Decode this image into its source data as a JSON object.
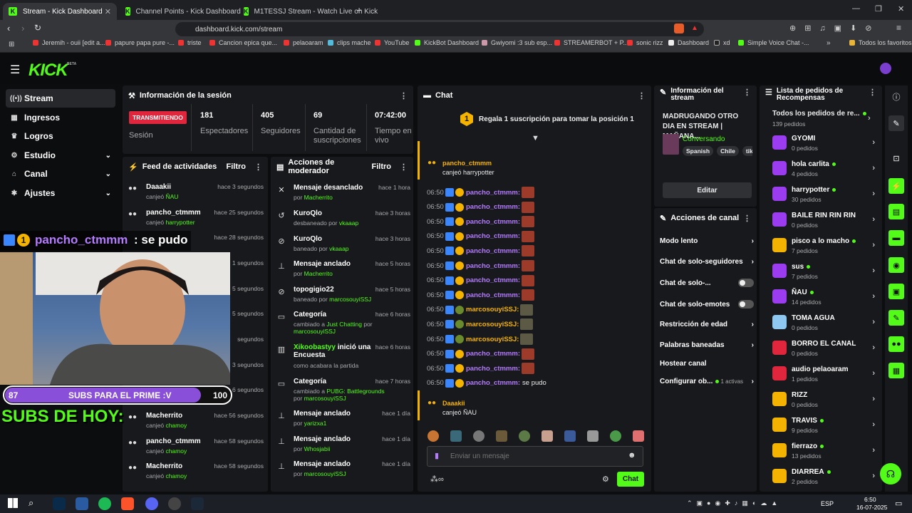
{
  "browser": {
    "tabs": [
      {
        "title": "Stream - Kick Dashboard",
        "active": true
      },
      {
        "title": "Channel Points - Kick Dashboard",
        "active": false
      },
      {
        "title": "M1TESSJ Stream - Watch Live on Kick",
        "active": false
      }
    ],
    "url": "dashboard.kick.com/stream",
    "bookmarks": [
      "Jeremih - ouii [edit a...",
      "papure papa pure -...",
      "triste",
      "Cancion epica que...",
      "pelaoaram",
      "clips mache",
      "YouTube",
      "KickBot Dashboard",
      "Gwiyomi :3 sub esp...",
      "STREAMERBOT + P...",
      "sonic rizz",
      "Dashboard",
      "xd",
      "Simple Voice Chat -..."
    ],
    "all_favorites": "Todos los favoritos"
  },
  "header": {
    "logo": "KICK",
    "beta": "BETA"
  },
  "sidebar": {
    "items": [
      {
        "label": "Stream",
        "icon": "broadcast-icon",
        "active": true
      },
      {
        "label": "Ingresos",
        "icon": "wallet-icon"
      },
      {
        "label": "Logros",
        "icon": "trophy-icon"
      },
      {
        "label": "Estudio",
        "icon": "studio-icon",
        "expandable": true
      },
      {
        "label": "Canal",
        "icon": "channel-icon",
        "expandable": true
      },
      {
        "label": "Ajustes",
        "icon": "settings-icon",
        "expandable": true
      }
    ]
  },
  "session": {
    "title": "Información de la sesión",
    "status": "TRANSMITIENDO",
    "status_label": "Sesión",
    "stats": [
      {
        "value": "181",
        "label": "Espectadores"
      },
      {
        "value": "405",
        "label": "Seguidores"
      },
      {
        "value": "69",
        "label": "Cantidad de suscripciones"
      },
      {
        "value": "07:42:00",
        "label": "Tiempo en vivo"
      }
    ]
  },
  "activity": {
    "title": "Feed de actividades",
    "filter": "Filtro",
    "items": [
      {
        "user": "Daaakii",
        "action": "canjeó",
        "target": "ÑAU",
        "time": "hace 3 segundos"
      },
      {
        "user": "pancho_ctmmm",
        "action": "canjeó",
        "target": "harrypotter",
        "time": "hace 25 segundos"
      },
      {
        "user": "",
        "action": "",
        "target": "harrypotter",
        "time": "hace 28 segundos"
      },
      {
        "user": "",
        "action": "",
        "target": "",
        "time": "1 segundos"
      },
      {
        "user": "",
        "action": "",
        "target": "",
        "time": "5 segundos"
      },
      {
        "user": "",
        "action": "",
        "target": "",
        "time": "5 segundos"
      },
      {
        "user": "",
        "action": "",
        "target": "",
        "time": "segundos"
      },
      {
        "user": "",
        "action": "",
        "target": "",
        "time": "3 segundos"
      },
      {
        "user": "",
        "action": "",
        "target": "",
        "time": "6 segundos"
      },
      {
        "user": "Macherrito",
        "action": "canjeó",
        "target": "chamoy",
        "time": "hace 56 segundos"
      },
      {
        "user": "pancho_ctmmm",
        "action": "canjeó",
        "target": "chamoy",
        "time": "hace 58 segundos"
      },
      {
        "user": "Macherrito",
        "action": "canjeó",
        "target": "chamoy",
        "time": "hace 58 segundos"
      }
    ]
  },
  "moderator": {
    "title": "Acciones de moderador",
    "filter": "Filtro",
    "items": [
      {
        "icon": "unpin-icon",
        "title": "Mensaje desanclado",
        "sub": "por",
        "by": "Macherrito",
        "time": "hace 1 hora"
      },
      {
        "icon": "unban-icon",
        "title": "KuroQlo",
        "sub": "desbaneado por",
        "by": "vkaaap",
        "time": "hace 3 horas"
      },
      {
        "icon": "ban-icon",
        "title": "KuroQlo",
        "sub": "baneado por",
        "by": "vkaaap",
        "time": "hace 3 horas"
      },
      {
        "icon": "pin-icon",
        "title": "Mensaje anclado",
        "sub": "por",
        "by": "Macherrito",
        "time": "hace 5 horas"
      },
      {
        "icon": "ban-icon",
        "title": "topogigio22",
        "sub": "baneado por",
        "by": "marcosouyiSSJ",
        "time": "hace 5 horas"
      },
      {
        "icon": "category-icon",
        "title": "Categoría",
        "sub": "cambiado a",
        "by": "Just Chatting",
        "sub2": "por",
        "by2": "marcosouyiSSJ",
        "time": "hace 6 horas"
      },
      {
        "icon": "poll-icon",
        "title_green": "Xikoobastyy",
        "title": "inició una Encuesta",
        "sub": "como acabara la partida",
        "time": "hace 6 horas"
      },
      {
        "icon": "category-icon",
        "title": "Categoría",
        "sub": "cambiado a",
        "by": "PUBG: Battlegrounds",
        "sub2": "por",
        "by2": "marcosouyiSSJ",
        "time": "hace 7 horas"
      },
      {
        "icon": "pin-icon",
        "title": "Mensaje anclado",
        "sub": "por",
        "by": "yarizxa1",
        "time": "hace 1 día"
      },
      {
        "icon": "pin-icon",
        "title": "Mensaje anclado",
        "sub": "por",
        "by": "Whosjabii",
        "time": "hace 1 día"
      },
      {
        "icon": "pin-icon",
        "title": "Mensaje anclado",
        "sub": "por",
        "by": "marcosouyiSSJ",
        "time": "hace 1 día"
      }
    ]
  },
  "chat": {
    "title": "Chat",
    "gift_banner": "Regala 1 suscripción para tomar la posición 1",
    "gift_position": "1",
    "top_event": {
      "user": "pancho_ctmmm",
      "text": "canjeó",
      "target": "harrypotter"
    },
    "messages": [
      {
        "time": "06:50",
        "user": "pancho_ctmmm:",
        "kind": "p"
      },
      {
        "time": "06:50",
        "user": "pancho_ctmmm:",
        "kind": "p"
      },
      {
        "time": "06:50",
        "user": "pancho_ctmmm:",
        "kind": "p"
      },
      {
        "time": "06:50",
        "user": "pancho_ctmmm:",
        "kind": "p"
      },
      {
        "time": "06:50",
        "user": "pancho_ctmmm:",
        "kind": "p"
      },
      {
        "time": "06:50",
        "user": "pancho_ctmmm:",
        "kind": "p"
      },
      {
        "time": "06:50",
        "user": "pancho_ctmmm:",
        "kind": "p"
      },
      {
        "time": "06:50",
        "user": "pancho_ctmmm:",
        "kind": "p"
      },
      {
        "time": "06:50",
        "user": "marcosouyiSSJ:",
        "kind": "m"
      },
      {
        "time": "06:50",
        "user": "marcosouyiSSJ:",
        "kind": "m"
      },
      {
        "time": "06:50",
        "user": "marcosouyiSSJ:",
        "kind": "m"
      },
      {
        "time": "06:50",
        "user": "pancho_ctmmm:",
        "kind": "p"
      },
      {
        "time": "06:50",
        "user": "pancho_ctmmm:",
        "kind": "p"
      },
      {
        "time": "06:50",
        "user": "pancho_ctmmm:",
        "kind": "p",
        "text": "se pudo"
      }
    ],
    "bottom_event": {
      "user": "Daaakii",
      "text": "canjeó",
      "target": "ÑAU"
    },
    "input_placeholder": "Enviar un mensaje",
    "send_label": "Chat"
  },
  "overlay": {
    "alert_user": "pancho_ctmmm",
    "alert_text": ": se pudo",
    "badge_num": "1",
    "goal_current": "87",
    "goal_label": "SUBS PARA EL PRIME :V",
    "goal_target": "100",
    "goal_fraction": 0.87,
    "subs_today": "SUBS DE HOY:"
  },
  "stream_info": {
    "title": "Información del stream",
    "stream_title": "MADRUGANDO OTRO DIA EN STREAM | MAÑANA...",
    "category": "Conversando",
    "tags": [
      "Spanish",
      "Chile",
      "tik"
    ],
    "edit": "Editar"
  },
  "channel_actions": {
    "title": "Acciones de canal",
    "items": [
      {
        "label": "Modo lento",
        "type": "arrow"
      },
      {
        "label": "Chat de solo-seguidores",
        "type": "arrow"
      },
      {
        "label": "Chat de solo-...",
        "type": "toggle"
      },
      {
        "label": "Chat de solo-emotes",
        "type": "toggle"
      },
      {
        "label": "Restricción de edad",
        "type": "arrow"
      },
      {
        "label": "Palabras baneadas",
        "type": "arrow"
      },
      {
        "label": "Hostear canal",
        "type": "none"
      },
      {
        "label": "Configurar ob...",
        "type": "arrow",
        "extra": "1 activas"
      }
    ]
  },
  "rewards": {
    "title": "Lista de pedidos de Recompensas",
    "all_title": "Todos los pedidos de re...",
    "all_count": "139 pedidos",
    "items": [
      {
        "name": "GYOMI",
        "count": "0 pedidos",
        "color": "#9b3cf0",
        "live": false
      },
      {
        "name": "hola carlita",
        "count": "4 pedidos",
        "color": "#9b3cf0",
        "live": true
      },
      {
        "name": "harrypotter",
        "count": "30 pedidos",
        "color": "#9b3cf0",
        "live": true
      },
      {
        "name": "BAILE RIN RIN RIN",
        "count": "0 pedidos",
        "color": "#9b3cf0",
        "live": false
      },
      {
        "name": "pisco a lo macho",
        "count": "7 pedidos",
        "color": "#f5b301",
        "live": true
      },
      {
        "name": "sus",
        "count": "7 pedidos",
        "color": "#9b3cf0",
        "live": true
      },
      {
        "name": "ÑAU",
        "count": "14 pedidos",
        "color": "#9b3cf0",
        "live": true
      },
      {
        "name": "TOMA AGUA",
        "count": "0 pedidos",
        "color": "#8ec8f0",
        "live": false
      },
      {
        "name": "BORRO EL CANAL",
        "count": "0 pedidos",
        "color": "#e0263c",
        "live": false
      },
      {
        "name": "audio pelaoaram",
        "count": "1 pedidos",
        "color": "#e0263c",
        "live": false
      },
      {
        "name": "RIZZ",
        "count": "0 pedidos",
        "color": "#f5b301",
        "live": false
      },
      {
        "name": "TRAVIS",
        "count": "9 pedidos",
        "color": "#f5b301",
        "live": true
      },
      {
        "name": "fierrazo",
        "count": "13 pedidos",
        "color": "#f5b301",
        "live": true
      },
      {
        "name": "DIARREA",
        "count": "2 pedidos",
        "color": "#f5b301",
        "live": true
      }
    ]
  },
  "taskbar": {
    "lang": "ESP",
    "time": "6:50",
    "date": "16-07-2025"
  },
  "colors": {
    "accent": "#53fc18",
    "live": "#e0263c",
    "panel": "#18191c",
    "purple": "#b47bff",
    "gold": "#f5b301"
  }
}
